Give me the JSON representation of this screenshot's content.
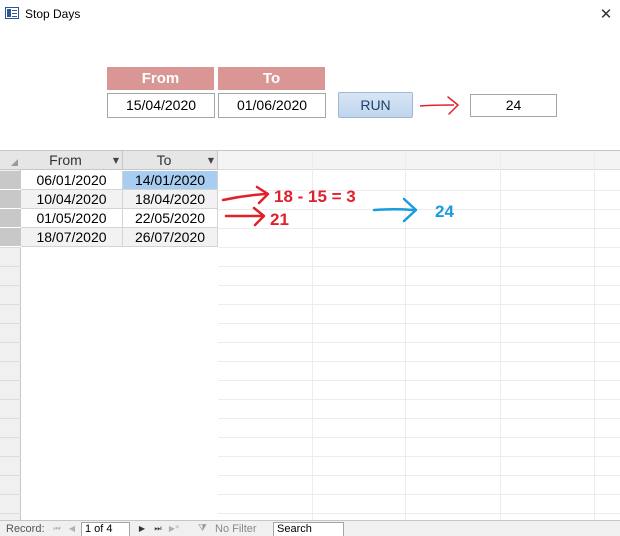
{
  "window": {
    "title": "Stop Days",
    "close_icon": "close-icon"
  },
  "form": {
    "from_label": "From",
    "to_label": "To",
    "from_value": "15/04/2020",
    "to_value": "01/06/2020",
    "run_label": "RUN",
    "result_value": "24"
  },
  "grid": {
    "columns": [
      "From",
      "To"
    ],
    "rows": [
      {
        "from": "06/01/2020",
        "to": "14/01/2020"
      },
      {
        "from": "10/04/2020",
        "to": "18/04/2020"
      },
      {
        "from": "01/05/2020",
        "to": "22/05/2020"
      },
      {
        "from": "18/07/2020",
        "to": "26/07/2020"
      }
    ]
  },
  "annotations": {
    "calc_row2": "18 - 15 = 3",
    "calc_row3": "21",
    "total": "24",
    "red_color": "#e0202a",
    "blue_color": "#1a9be0"
  },
  "navbar": {
    "record_label": "Record:",
    "record_position": "1 of 4",
    "filter_label": "No Filter",
    "search_placeholder": "Search"
  }
}
